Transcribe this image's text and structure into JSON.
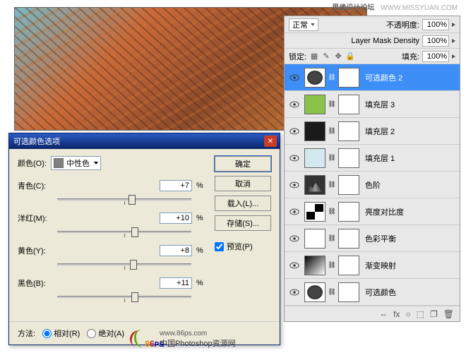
{
  "watermark": {
    "text": "思缘设计论坛",
    "url": "WWW.MISSYUAN.COM"
  },
  "dialog": {
    "title": "可选颜色选项",
    "color_label": "颜色(O):",
    "color_value": "中性色",
    "channels": {
      "cyan": {
        "label": "青色(C):",
        "value": "+7",
        "unit": "%"
      },
      "magenta": {
        "label": "洋红(M):",
        "value": "+10",
        "unit": "%"
      },
      "yellow": {
        "label": "黄色(Y):",
        "value": "+8",
        "unit": "%"
      },
      "black": {
        "label": "黑色(B):",
        "value": "+11",
        "unit": "%"
      }
    },
    "buttons": {
      "ok": "确定",
      "cancel": "取消",
      "load": "载入(L)...",
      "save": "存储(S)..."
    },
    "preview": "预览(P)",
    "method": {
      "label": "方法:",
      "relative": "相对(R)",
      "absolute": "绝对(A)"
    }
  },
  "branding": {
    "url": "www.86ps.com",
    "tagline": "中国Photoshop资源网"
  },
  "layers_panel": {
    "blend": "正常",
    "opacity_label": "不透明度:",
    "opacity": "100%",
    "mask_density_label": "Layer Mask Density",
    "mask_density": "100%",
    "lock_label": "锁定:",
    "fill_label": "填充:",
    "fill": "100%",
    "items": [
      {
        "name": "可选颜色 2",
        "selected": true
      },
      {
        "name": "填充层 3"
      },
      {
        "name": "填充层 2"
      },
      {
        "name": "填充层 1"
      },
      {
        "name": "色阶"
      },
      {
        "name": "亮度对比度"
      },
      {
        "name": "色彩平衡"
      },
      {
        "name": "渐变映射"
      },
      {
        "name": "可选颜色"
      }
    ],
    "footer_icons": [
      "⇔",
      "fx",
      "○",
      "⬚",
      "❐",
      "🗑"
    ]
  }
}
